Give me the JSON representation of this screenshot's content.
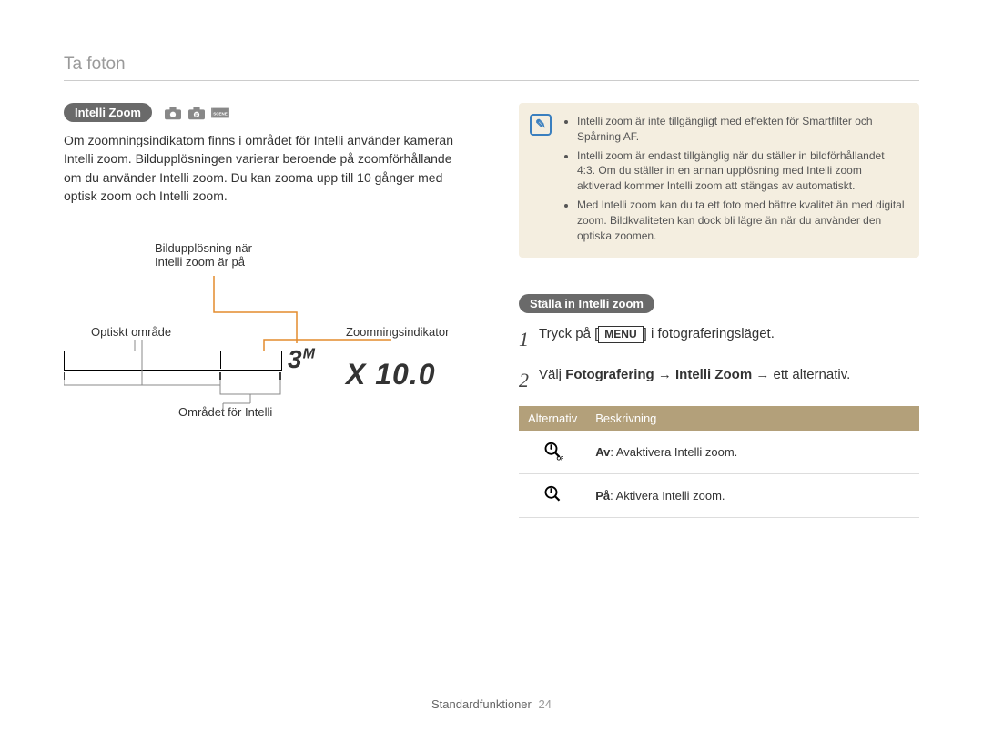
{
  "breadcrumb": "Ta foton",
  "left": {
    "heading_pill": "Intelli Zoom",
    "paragraph": "Om zoomningsindikatorn finns i området för Intelli använder kameran Intelli zoom. Bildupplösningen varierar beroende på zoomförhållande om du använder Intelli zoom. Du kan zooma upp till 10 gånger med optisk zoom och Intelli zoom.",
    "diagram": {
      "resolution_label_l1": "Bildupplösning när",
      "resolution_label_l2": "Intelli zoom är på",
      "optical_area_label": "Optiskt område",
      "indicator_label": "Zoomningsindikator",
      "intelli_area_label": "Området för Intelli",
      "resolution_value": "3",
      "resolution_value_sup": "M",
      "zoom_value": "X 10.0"
    }
  },
  "right": {
    "info_bullets": [
      "Intelli zoom är inte tillgängligt med effekten för Smartfilter och Spårning AF.",
      "Intelli zoom är endast tillgänglig när du ställer in bildförhållandet 4:3. Om du ställer in en annan upplösning med Intelli zoom aktiverad kommer Intelli zoom att stängas av automatiskt.",
      "Med Intelli zoom kan du ta ett foto med bättre kvalitet än med digital zoom. Bildkvaliteten kan dock bli lägre än när du använder den optiska zoomen."
    ],
    "subheading_pill": "Ställa in Intelli zoom",
    "steps": {
      "1_pre": "Tryck på [",
      "1_key": "MENU",
      "1_post": "] i fotograferingsläget.",
      "2_pre": "Välj ",
      "2_bold": "Fotografering → Intelli Zoom",
      "2_post": " → ett alternativ."
    },
    "table": {
      "h1": "Alternativ",
      "h2": "Beskrivning",
      "row1_bold": "Av",
      "row1_text": ": Avaktivera Intelli zoom.",
      "row2_bold": "På",
      "row2_text": ": Aktivera Intelli zoom."
    }
  },
  "footer": {
    "section": "Standardfunktioner",
    "page": "24"
  }
}
